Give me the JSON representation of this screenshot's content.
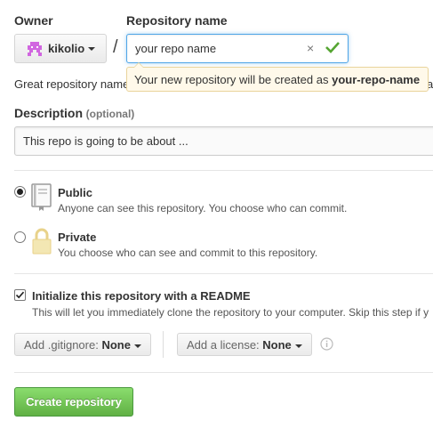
{
  "owner": {
    "label": "Owner",
    "name": "kikolio"
  },
  "separator": "/",
  "repository_name": {
    "label": "Repository name",
    "value": "your repo name",
    "tooltip_prefix": "Your new repository will be created as ",
    "tooltip_name": "your-repo-name",
    "hint_visible": "Great repository name",
    "hint_tail": "a"
  },
  "description": {
    "label": "Description",
    "optional": "(optional)",
    "value": "This repo is going to be about ..."
  },
  "visibility": {
    "public": {
      "label": "Public",
      "description": "Anyone can see this repository. You choose who can commit."
    },
    "private": {
      "label": "Private",
      "description": "You choose who can see and commit to this repository."
    },
    "selected": "public"
  },
  "readme": {
    "label": "Initialize this repository with a README",
    "description": "This will let you immediately clone the repository to your computer. Skip this step if y",
    "checked": true
  },
  "gitignore": {
    "prefix": "Add .gitignore: ",
    "value": "None"
  },
  "license": {
    "prefix": "Add a license: ",
    "value": "None"
  },
  "create_button": {
    "label": "Create repository"
  },
  "colors": {
    "avatar": "#d166e0",
    "tooltip_bg": "#fff9ea",
    "tooltip_border": "#e9d49b",
    "focus": "#51a7e8",
    "check": "#55a532",
    "create_button": "#60b044"
  }
}
